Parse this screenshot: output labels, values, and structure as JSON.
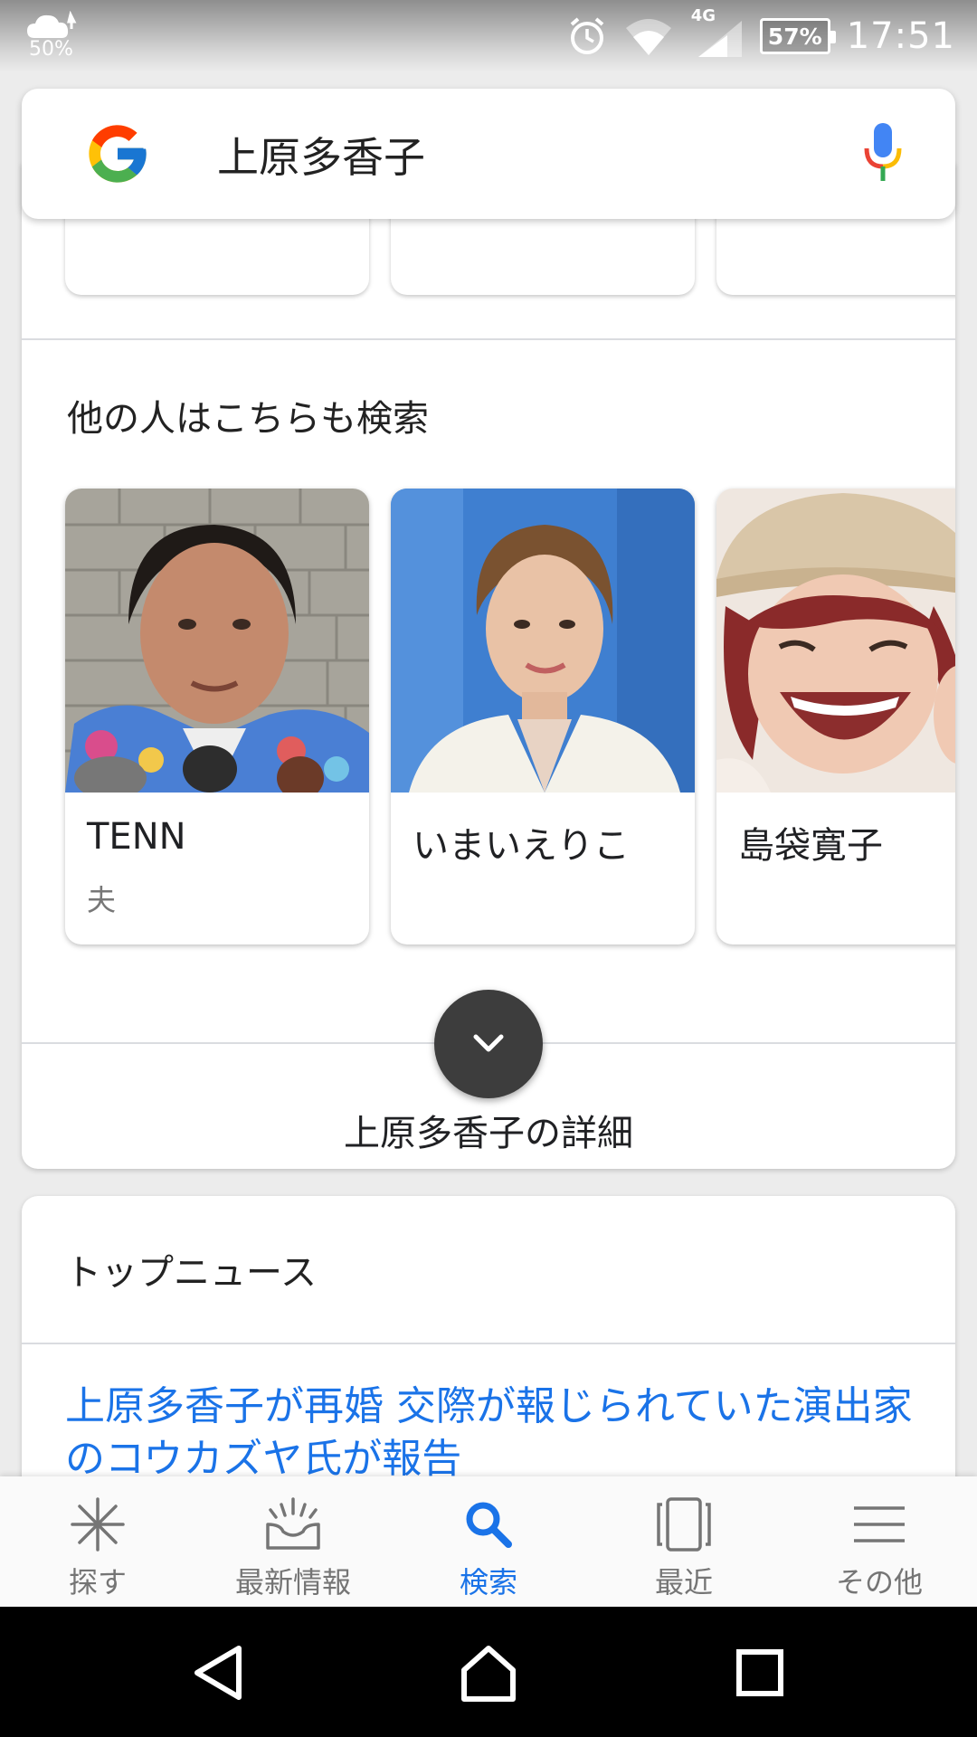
{
  "status_bar": {
    "weather_percent": "50%",
    "network_label": "4G",
    "battery": "57%",
    "time": "17:51"
  },
  "search": {
    "query": "上原多香子"
  },
  "related": {
    "title": "他の人はこちらも検索",
    "people": [
      {
        "name": "TENN",
        "relation": "夫"
      },
      {
        "name": "いまいえりこ",
        "relation": ""
      },
      {
        "name": "島袋寛子",
        "relation": ""
      }
    ]
  },
  "details_label": "上原多香子の詳細",
  "news": {
    "title": "トップニュース",
    "headline": "上原多香子が再婚 交際が報じられていた演出家のコウカズヤ氏が報告"
  },
  "bottom_nav": {
    "items": [
      {
        "label": "探す",
        "icon": "asterisk-icon"
      },
      {
        "label": "最新情報",
        "icon": "updates-tray-icon"
      },
      {
        "label": "検索",
        "icon": "search-icon",
        "active": true
      },
      {
        "label": "最近",
        "icon": "recent-cards-icon"
      },
      {
        "label": "その他",
        "icon": "menu-icon"
      }
    ]
  },
  "colors": {
    "accent": "#1a73e8",
    "link": "#1a73e8",
    "fab": "#3d3d3d"
  }
}
